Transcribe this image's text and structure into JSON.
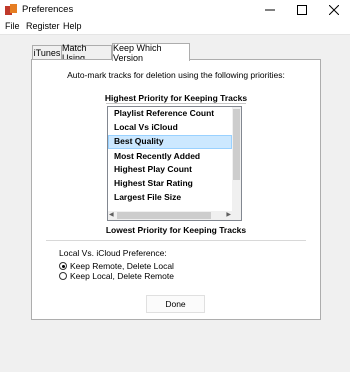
{
  "window": {
    "title": "Preferences"
  },
  "menu": [
    "File",
    "Register",
    "Help"
  ],
  "tabs": [
    "iTunes",
    "Match Using",
    "Keep Which Version"
  ],
  "panel": {
    "intro": "Auto-mark tracks for deletion using the following priorities:",
    "highest_label": "Highest Priority for Keeping Tracks",
    "lowest_label": "Lowest Priority for Keeping Tracks",
    "priority_list": [
      "Playlist Reference Count",
      "Local Vs iCloud",
      "Best Quality",
      "Most Recently Added",
      "Highest Play Count",
      "Highest Star Rating",
      "Largest File Size"
    ],
    "selected_item": "Best Quality",
    "pref_label": "Local Vs. iCloud Preference:",
    "radio_options": [
      "Keep Remote, Delete Local",
      "Keep Local, Delete Remote"
    ],
    "radio_selected": "Keep Remote, Delete Local",
    "done_label": "Done"
  },
  "colors": {
    "selection": "#cce8ff",
    "selection_border": "#99d1ff"
  }
}
